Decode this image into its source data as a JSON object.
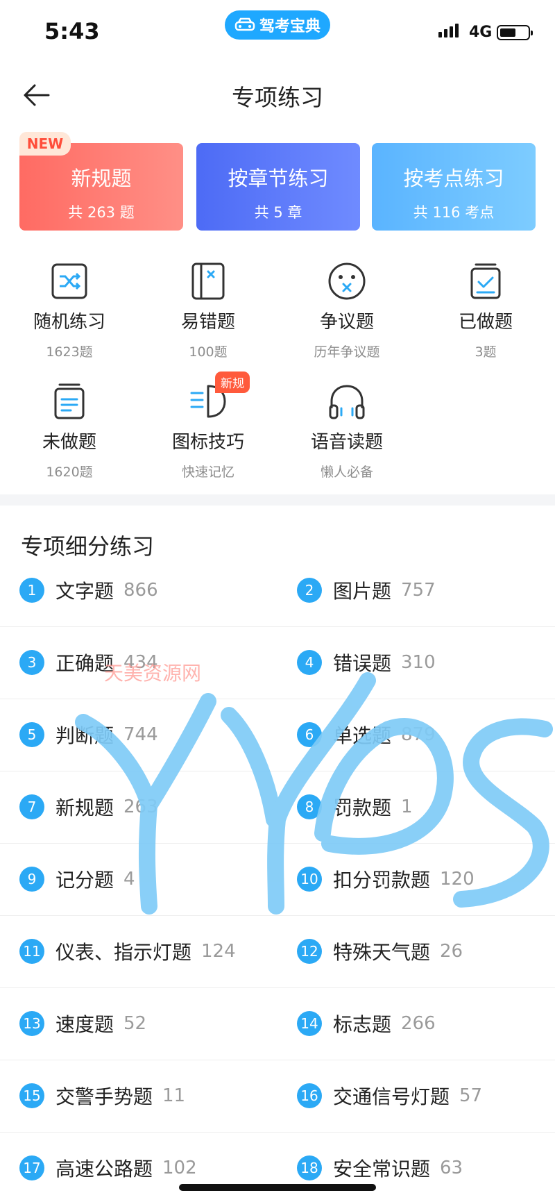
{
  "status": {
    "time": "5:43",
    "app_badge": "驾考宝典",
    "network": "4G"
  },
  "header": {
    "title": "专项练习"
  },
  "cards": [
    {
      "title": "新规题",
      "sub": "共 263 题",
      "badge": "NEW"
    },
    {
      "title": "按章节练习",
      "sub": "共 5 章"
    },
    {
      "title": "按考点练习",
      "sub": "共 116 考点"
    }
  ],
  "grid": [
    {
      "label": "随机练习",
      "sub": "1623题",
      "icon": "shuffle-icon"
    },
    {
      "label": "易错题",
      "sub": "100题",
      "icon": "wrong-book-icon"
    },
    {
      "label": "争议题",
      "sub": "历年争议题",
      "icon": "confused-face-icon"
    },
    {
      "label": "已做题",
      "sub": "3题",
      "icon": "done-check-icon"
    },
    {
      "label": "未做题",
      "sub": "1620题",
      "icon": "undone-list-icon"
    },
    {
      "label": "图标技巧",
      "sub": "快速记忆",
      "icon": "headlight-icon",
      "tag": "新规"
    },
    {
      "label": "语音读题",
      "sub": "懒人必备",
      "icon": "headphones-icon"
    }
  ],
  "section": {
    "title": "专项细分练习"
  },
  "list": [
    {
      "n": "1",
      "name": "文字题",
      "count": "866"
    },
    {
      "n": "2",
      "name": "图片题",
      "count": "757"
    },
    {
      "n": "3",
      "name": "正确题",
      "count": "434"
    },
    {
      "n": "4",
      "name": "错误题",
      "count": "310"
    },
    {
      "n": "5",
      "name": "判断题",
      "count": "744"
    },
    {
      "n": "6",
      "name": "单选题",
      "count": "879"
    },
    {
      "n": "7",
      "name": "新规题",
      "count": "263"
    },
    {
      "n": "8",
      "name": "罚款题",
      "count": "1"
    },
    {
      "n": "9",
      "name": "记分题",
      "count": "4"
    },
    {
      "n": "10",
      "name": "扣分罚款题",
      "count": "120"
    },
    {
      "n": "11",
      "name": "仪表、指示灯题",
      "count": "124"
    },
    {
      "n": "12",
      "name": "特殊天气题",
      "count": "26"
    },
    {
      "n": "13",
      "name": "速度题",
      "count": "52"
    },
    {
      "n": "14",
      "name": "标志题",
      "count": "266"
    },
    {
      "n": "15",
      "name": "交警手势题",
      "count": "11"
    },
    {
      "n": "16",
      "name": "交通信号灯题",
      "count": "57"
    },
    {
      "n": "17",
      "name": "高速公路题",
      "count": "102"
    },
    {
      "n": "18",
      "name": "安全常识题",
      "count": "63"
    }
  ],
  "watermark": "天美资源网",
  "colors": {
    "primary": "#2ba9f5",
    "card_red": "#ff6b63",
    "card_blue": "#4d6bf5",
    "card_sky": "#5ab4ff",
    "scribble": "#7fcbf7"
  }
}
